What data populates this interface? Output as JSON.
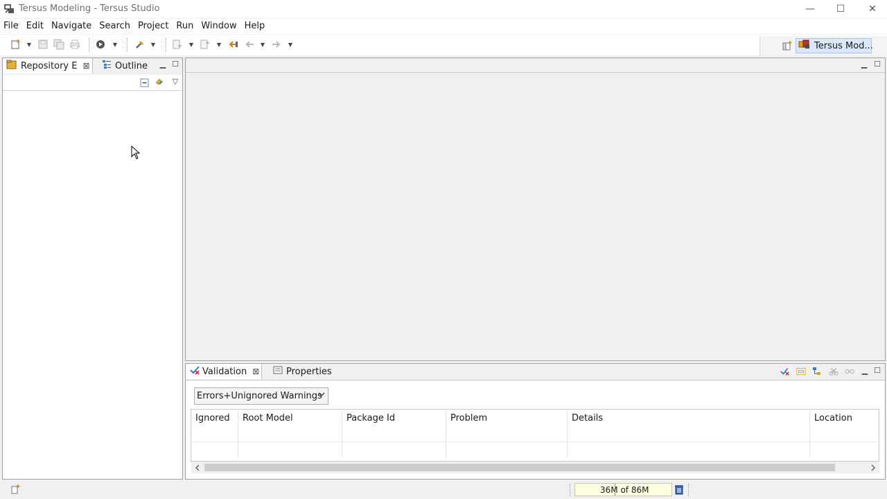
{
  "window": {
    "title": "Tersus Modeling - Tersus Studio",
    "controls": {
      "minimize": "—",
      "maximize": "☐",
      "close": "✕"
    }
  },
  "menu": [
    "File",
    "Edit",
    "Navigate",
    "Search",
    "Project",
    "Run",
    "Window",
    "Help"
  ],
  "toolbar": {
    "perspective_label": "Tersus Mod...",
    "icons": [
      "new-icon",
      "save-icon",
      "save-all-icon",
      "print-icon",
      "run-icon",
      "tools-icon",
      "next-annotation-icon",
      "previous-annotation-icon",
      "last-edit-icon",
      "back-icon",
      "forward-icon",
      "open-perspective-icon"
    ]
  },
  "left_panel": {
    "tabs": [
      {
        "label": "Repository E",
        "active": true
      },
      {
        "label": "Outline",
        "active": false
      }
    ]
  },
  "validation_panel": {
    "tabs": [
      {
        "label": "Validation",
        "active": true
      },
      {
        "label": "Properties",
        "active": false
      }
    ],
    "filter": {
      "selected": "Errors+Unignored Warnings"
    },
    "columns": [
      "Ignored",
      "Root Model",
      "Package Id",
      "Problem",
      "Details",
      "Location"
    ],
    "rows": []
  },
  "status": {
    "heap": {
      "used": "36M",
      "total": "86M",
      "text": "36M of 86M",
      "fraction": 0.42
    }
  },
  "colors": {
    "panel_border": "#a0a0a0",
    "perspective_active": "#dbe8f8",
    "heap_bg": "#ffffe1"
  }
}
